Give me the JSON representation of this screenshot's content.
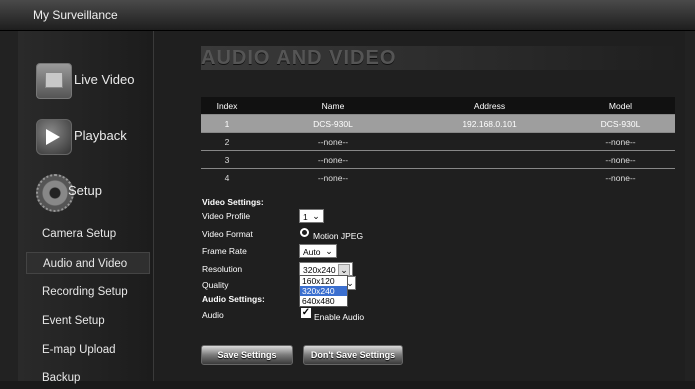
{
  "app": {
    "title": "My Surveillance"
  },
  "sidebar": {
    "big_items": [
      {
        "label": "Live Video"
      },
      {
        "label": "Playback"
      },
      {
        "label": "Setup"
      }
    ],
    "items": [
      {
        "label": "Camera Setup"
      },
      {
        "label": "Audio and Video"
      },
      {
        "label": "Recording Setup"
      },
      {
        "label": "Event Setup"
      },
      {
        "label": "E-map Upload"
      },
      {
        "label": "Backup"
      }
    ],
    "active_item": "Audio and Video"
  },
  "main": {
    "title": "AUDIO AND VIDEO",
    "table": {
      "headers": [
        "Index",
        "Name",
        "Address",
        "Model"
      ],
      "rows": [
        [
          "1",
          "DCS-930L",
          "192.168.0.101",
          "DCS-930L"
        ],
        [
          "2",
          "--none--",
          "",
          "--none--"
        ],
        [
          "3",
          "--none--",
          "",
          "--none--"
        ],
        [
          "4",
          "--none--",
          "",
          "--none--"
        ]
      ],
      "selected_row": 1
    },
    "video_settings": {
      "heading": "Video Settings:",
      "profile_label": "Video Profile",
      "profile_value": "1",
      "format_label": "Video Format",
      "format_value": "Motion JPEG",
      "frame_rate_label": "Frame Rate",
      "frame_rate_value": "Auto",
      "resolution_label": "Resolution",
      "resolution_value": "320x240",
      "resolution_options": [
        "160x120",
        "320x240",
        "640x480"
      ],
      "quality_label": "Quality"
    },
    "audio_settings": {
      "heading": "Audio Settings:",
      "audio_label": "Audio",
      "enable_label": "Enable Audio",
      "enabled": true
    },
    "buttons": {
      "save": "Save Settings",
      "dont_save": "Don't Save Settings"
    }
  }
}
